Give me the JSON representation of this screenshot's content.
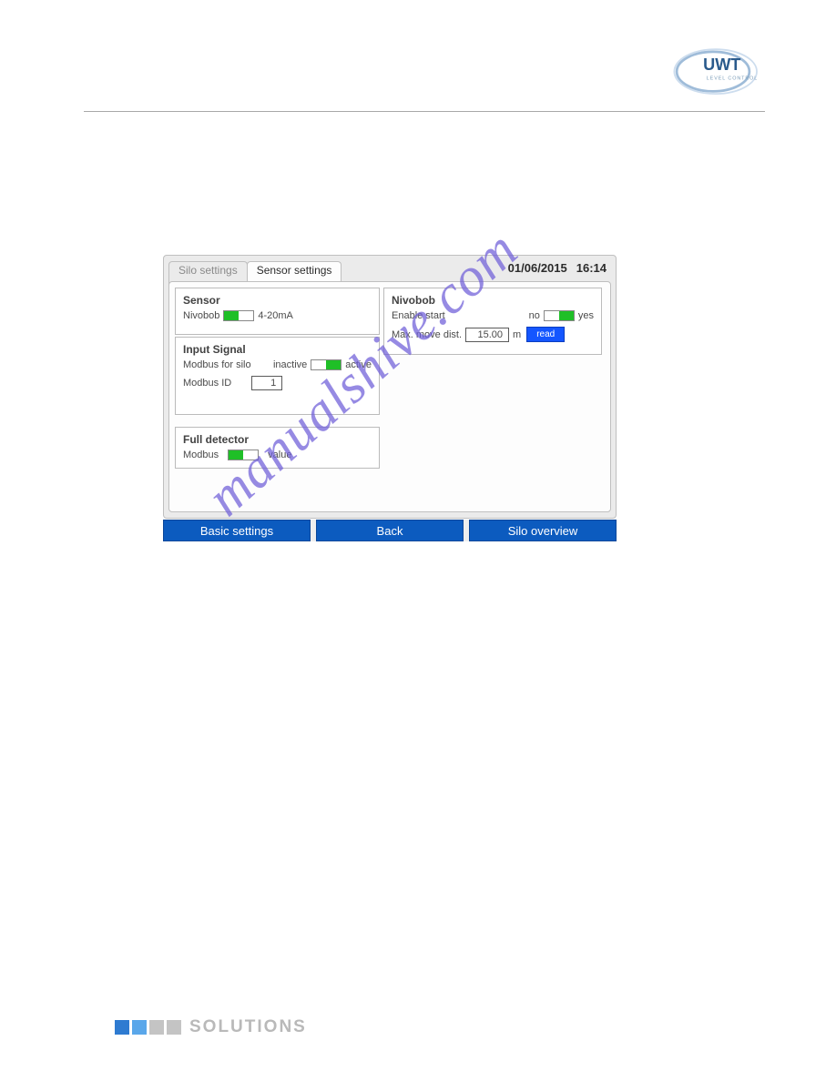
{
  "logo": {
    "brand_top": "UWT",
    "brand_bottom": "LEVEL CONTROL"
  },
  "panel": {
    "date": "01/06/2015",
    "time": "16:14",
    "tabs": [
      {
        "label": "Silo settings",
        "active": false
      },
      {
        "label": "Sensor settings",
        "active": true
      }
    ],
    "sensor": {
      "title": "Sensor",
      "type_label": "Nivobob",
      "toggle_right": "4-20mA"
    },
    "input_signal": {
      "title": "Input Signal",
      "modbus_for_silo_label": "Modbus for silo",
      "inactive": "inactive",
      "active": "active",
      "modbus_id_label": "Modbus ID",
      "modbus_id_value": "1"
    },
    "full_detector": {
      "title": "Full detector",
      "modbus_label": "Modbus",
      "value_label": "value"
    },
    "nivobob": {
      "title": "Nivobob",
      "enable_start_label": "Enable start",
      "no": "no",
      "yes": "yes",
      "max_move_label": "Max. move dist.",
      "max_move_value": "15.00",
      "unit": "m",
      "read_button": "read"
    }
  },
  "bottom": {
    "basic": "Basic settings",
    "back": "Back",
    "overview": "Silo overview"
  },
  "watermark": "manualshive.com",
  "footer": {
    "text": "SOLUTIONS",
    "colors": [
      "#2e7bd1",
      "#5aa7ea",
      "#c4c4c4",
      "#c4c4c4"
    ]
  }
}
